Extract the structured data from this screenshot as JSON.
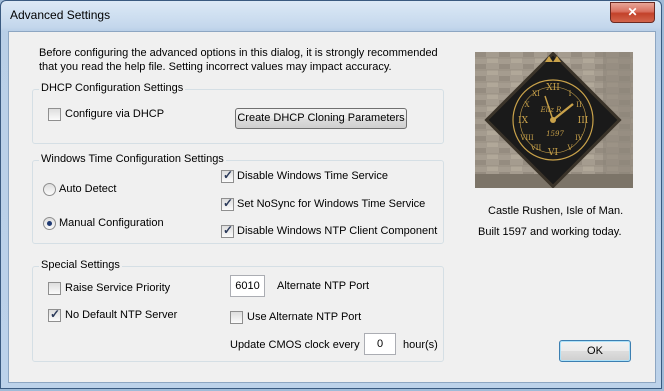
{
  "window": {
    "title": "Advanced Settings",
    "close_glyph": "✕"
  },
  "intro": {
    "line1": "Before configuring the advanced options in this dialog, it is strongly recommended",
    "line2": "that you read the help file. Setting incorrect values may impact accuracy."
  },
  "dhcp": {
    "group_label": "DHCP Configuration Settings",
    "configure_label": "Configure via DHCP",
    "configure_checked": false,
    "cloning_button": "Create DHCP Cloning Parameters"
  },
  "wintime": {
    "group_label": "Windows Time  Configuration Settings",
    "auto_detect": "Auto Detect",
    "manual_config": "Manual Configuration",
    "selected": "manual",
    "disable_service": "Disable Windows Time Service",
    "disable_service_checked": true,
    "set_nosync": "Set NoSync for Windows Time Service",
    "set_nosync_checked": true,
    "disable_ntp_client": "Disable Windows NTP Client Component",
    "disable_ntp_client_checked": true
  },
  "special": {
    "group_label": "Special Settings",
    "raise_priority": "Raise Service Priority",
    "raise_priority_checked": false,
    "no_default_ntp": "No Default NTP Server",
    "no_default_ntp_checked": true,
    "port_value": "6010",
    "port_label": "Alternate NTP Port",
    "use_alt_port": "Use Alternate NTP Port",
    "use_alt_port_checked": false,
    "cmos_label": "Update CMOS clock every",
    "cmos_value": "0",
    "cmos_unit": "hour(s)"
  },
  "photo": {
    "caption1": "Castle Rushen, Isle of Man.",
    "caption2": "Built 1597 and working today.",
    "clock_text": "Eliz R",
    "clock_year": "1597",
    "dial_color": "#1a1a1a",
    "gold_color": "#c9a24a",
    "wall_color": "#9a9286"
  },
  "ok_button": "OK"
}
